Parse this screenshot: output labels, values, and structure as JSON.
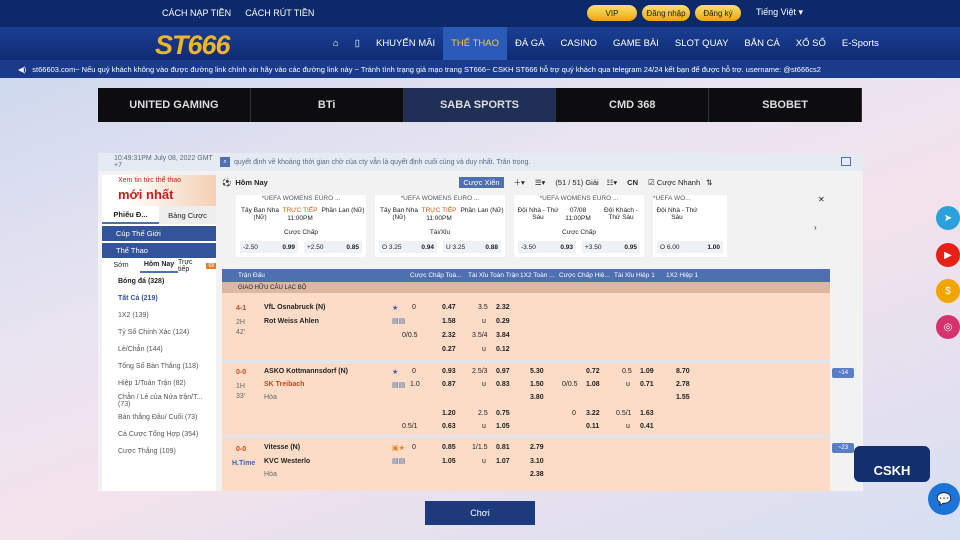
{
  "top": {
    "link1": "CÁCH NẠP TIỀN",
    "link2": "CÁCH RÚT TIỀN",
    "vip": "VIP",
    "login": "Đăng nhập",
    "register": "Đăng ký",
    "language": "Tiếng Việt"
  },
  "logo": "ST666",
  "nav": [
    "KHUYẾN MÃI",
    "THỂ THAO",
    "ĐÁ GÀ",
    "CASINO",
    "GAME BÀI",
    "SLOT QUAY",
    "BẮN CÁ",
    "XỔ SỐ",
    "E-Sports"
  ],
  "ticker": "st66603.com~ Nếu quý khách không vào được đường link chính xin hãy vào các đường link này ~ Tránh tình trạng giả mạo trang ST666~ CSKH ST666 hỗ trợ quý khách qua telegram 24/24 kết bạn để được hỗ trợ. username: @st666cs2",
  "providers": [
    "UNITED GAMING",
    "BTi",
    "SABA SPORTS",
    "CMD 368",
    "SBOBET"
  ],
  "info": {
    "time": "10:49:31PM July 08, 2022 GMT +7",
    "message": "quyết định về khoảng thời gian chờ của cty vẫn là quyết định cuối cùng và duy nhất. Trân trọng."
  },
  "left": {
    "promo_small": "Xem tin tức thể thao",
    "promo_big": "mới nhất",
    "tab1": "Phiếu Đ...",
    "tab2": "Bảng Cược",
    "sec1": "Cúp Thế Giới",
    "sec2": "Thể Thao",
    "sub": [
      "Sớm",
      "Hôm Nay",
      "Trực tiếp"
    ],
    "badge": "68",
    "sport": "Bóng đá (328)",
    "items": [
      "Tất Cả (219)",
      "1X2 (139)",
      "Tỷ Số Chính Xác (124)",
      "Lẻ/Chẵn (144)",
      "Tổng Số Bàn Thắng (118)",
      "Hiệp 1/Toàn Trận (82)",
      "Chẵn / Lẻ của Nửa trận/T... (73)",
      "Bàn thắng Đầu/ Cuối (73)",
      "Cá Cược Tổng Hợp (354)",
      "Cược Thắng (109)"
    ]
  },
  "toolbar": {
    "title": "Hôm Nay",
    "mix": "Cược Xiên",
    "count": "(51 / 51) Giải",
    "lang": "CN",
    "fast": "Cược Nhanh"
  },
  "cards": [
    {
      "league": "*UEFA WOMENS EURO ...",
      "home": "Tây Ban Nha (Nữ)",
      "live": "TRỰC TIẾP",
      "time": "11:00PM",
      "away": "Phần Lan (Nữ)",
      "market": "Cược Chấp",
      "h1": "-2.50",
      "o1": "0.99",
      "h2": "+2.50",
      "o2": "0.85"
    },
    {
      "league": "*UEFA WOMENS EURO ...",
      "home": "Tây Ban Nha (Nữ)",
      "live": "TRỰC TIẾP",
      "time": "11:00PM",
      "away": "Phần Lan (Nữ)",
      "market": "Tài/Xỉu",
      "h1": "O 3.25",
      "o1": "0.94",
      "h2": "U 3.25",
      "o2": "0.88"
    },
    {
      "league": "*UEFA WOMENS EURO ...",
      "home": "Đội Nhà - Thứ Sáu",
      "live": "07/08",
      "time": "11:00PM",
      "away": "Đội Khách - Thứ Sáu",
      "market": "Cược Chấp",
      "h1": "-3.50",
      "o1": "0.93",
      "h2": "+3.50",
      "o2": "0.95"
    },
    {
      "league": "*UEFA WO...",
      "home": "Đội Nhà - Thứ Sáu",
      "live": "",
      "time": "",
      "away": "",
      "market": "",
      "h1": "O 6.00",
      "o1": "1.00",
      "h2": "",
      "o2": ""
    }
  ],
  "columns": [
    "Trận Đấu",
    "Cược Chấp Toà...",
    "Tài Xỉu Toàn Trận",
    "1X2 Toàn ...",
    "Cược Chấp Hiệ...",
    "Tài Xỉu Hiệp 1",
    "1X2 Hiệp 1"
  ],
  "league": "GIAO HỮU CÂU LẠC BỘ",
  "matches": [
    {
      "score": "4-1",
      "period": "2H",
      "minute": "42'",
      "home": "VfL Osnabruck (N)",
      "away": "Rot Weiss Ahlen",
      "draw": "",
      "ft_hdp": [
        "0",
        "0.47",
        "",
        "1.58",
        "0/0.5",
        "2.32",
        "",
        "0.27"
      ],
      "ft_ou": [
        "3.5",
        "2.32",
        "u",
        "0.29",
        "3.5/4",
        "3.84",
        "u",
        "0.12"
      ],
      "ft_1x2": [],
      "h1_hdp": [],
      "h1_ou": [],
      "h1_1x2": [],
      "more": ""
    },
    {
      "score": "0-0",
      "period": "1H",
      "minute": "33'",
      "home": "ASKO Kottmannsdorf (N)",
      "away": "SK Treibach",
      "draw": "Hòa",
      "ft_hdp": [
        "0",
        "0.93",
        "1.0",
        "0.87",
        "",
        "1.20",
        "0.5/1",
        "0.63"
      ],
      "ft_ou": [
        "2.5/3",
        "0.97",
        "u",
        "0.83",
        "2.5",
        "0.75",
        "u",
        "1.05"
      ],
      "ft_1x2": [
        "5.30",
        "1.50",
        "3.80"
      ],
      "h1_hdp": [
        "",
        "0.72",
        "0/0.5",
        "1.08",
        "0",
        "3.22",
        "",
        "0.11"
      ],
      "h1_ou": [
        "0.5",
        "1.09",
        "u",
        "0.71",
        "0.5/1",
        "1.63",
        "u",
        "0.41"
      ],
      "h1_1x2": [
        "8.70",
        "2.78",
        "1.55"
      ],
      "more": "14"
    },
    {
      "score": "0-0",
      "period": "H.Time",
      "minute": "",
      "home": "Vitesse (N)",
      "away": "KVC Westerlo",
      "draw": "Hòa",
      "ft_hdp": [
        "0",
        "0.85",
        "",
        "1.05"
      ],
      "ft_ou": [
        "1/1.5",
        "0.81",
        "u",
        "1.07"
      ],
      "ft_1x2": [
        "2.79",
        "3.10",
        "2.38"
      ],
      "h1_hdp": [],
      "h1_ou": [],
      "h1_1x2": [],
      "more": "23"
    }
  ],
  "play_button": "Chơi",
  "cskh": "CSKH",
  "colors": {
    "nav_bg": "#1b3f94",
    "accent": "#f7c948",
    "odds_bg": "#fcdcc6",
    "header_blue": "#4e6fb0"
  }
}
